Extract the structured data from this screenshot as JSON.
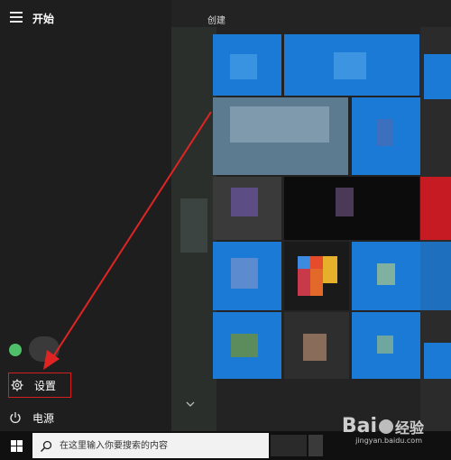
{
  "start": {
    "title": "开始"
  },
  "menu": {
    "settings_label": "设置",
    "power_label": "电源"
  },
  "tiles_group": {
    "label": "创建"
  },
  "taskbar": {
    "search_placeholder": "在这里输入你要搜索的内容"
  },
  "watermark": {
    "brand_prefix": "Bai",
    "brand_suffix": "经验",
    "url": "jingyan.baidu.com"
  },
  "icons": [
    "hamburger-icon",
    "user-avatar-icon",
    "gear-icon",
    "power-icon",
    "chevron-down-icon",
    "windows-logo-icon",
    "search-icon"
  ],
  "colors": {
    "accent": "#0078d7",
    "annotation": "#e02424"
  }
}
